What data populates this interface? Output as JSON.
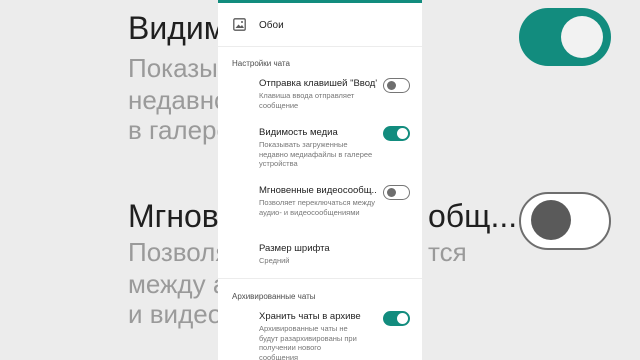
{
  "background": {
    "title_top": "Видим",
    "sub_top": [
      "Показыв",
      "недавно",
      "в галере"
    ],
    "title_mid": "Мгнове",
    "title_mid_right": "общ...",
    "sub_mid": [
      "Позволя",
      "между а",
      "и видео"
    ],
    "sub_mid_right": [
      "тся",
      "",
      ""
    ]
  },
  "wallpaper": {
    "label": "Обои",
    "icon": "wallpaper-icon"
  },
  "chat_settings": {
    "section_title": "Настройки чата",
    "items": [
      {
        "title": "Отправка клавишей \"Ввод\"",
        "subtitle": "Клавиша ввода отправляет сообщение",
        "enabled": false
      },
      {
        "title": "Видимость медиа",
        "subtitle": "Показывать загруженные недавно медиафайлы в галерее устройства",
        "enabled": true
      },
      {
        "title": "Мгновенные видеосообщ...",
        "subtitle": "Позволяет переключаться между аудио- и видеосообщениями",
        "enabled": false
      },
      {
        "title": "Размер шрифта",
        "subtitle": "Средний"
      }
    ]
  },
  "archived": {
    "section_title": "Архивированные чаты",
    "items": [
      {
        "title": "Хранить чаты в архиве",
        "subtitle": "Архивированные чаты не будут разархивированы при получении нового сообщения",
        "enabled": true
      }
    ]
  },
  "colors": {
    "accent": "#128c7e",
    "topbar": "#128c7e"
  }
}
